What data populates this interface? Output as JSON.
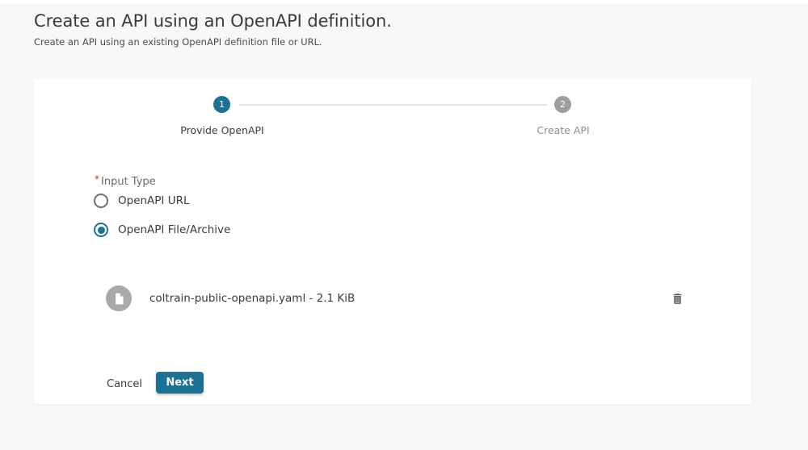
{
  "page": {
    "title": "Create an API using an OpenAPI definition.",
    "subtitle": "Create an API using an existing OpenAPI definition file or URL."
  },
  "colors": {
    "primary": "#1c7196",
    "step_inactive": "#9e9e9e",
    "page_background": "#f7f8f8",
    "card_background": "#ffffff",
    "required_red": "#d93025"
  },
  "stepper": {
    "steps": [
      {
        "number": "1",
        "label": "Provide OpenAPI",
        "state": "active"
      },
      {
        "number": "2",
        "label": "Create API",
        "state": "inactive"
      }
    ]
  },
  "form": {
    "input_type": {
      "required_marker": "*",
      "label": "Input Type",
      "options": [
        {
          "label": "OpenAPI URL",
          "selected": false
        },
        {
          "label": "OpenAPI File/Archive",
          "selected": true
        }
      ]
    },
    "file": {
      "display_text": "coltrain-public-openapi.yaml - 2.1 KiB",
      "icons": {
        "avatar": "document-icon",
        "action": "trash-icon"
      }
    },
    "actions": {
      "cancel_label": "Cancel",
      "next_label": "Next"
    }
  }
}
